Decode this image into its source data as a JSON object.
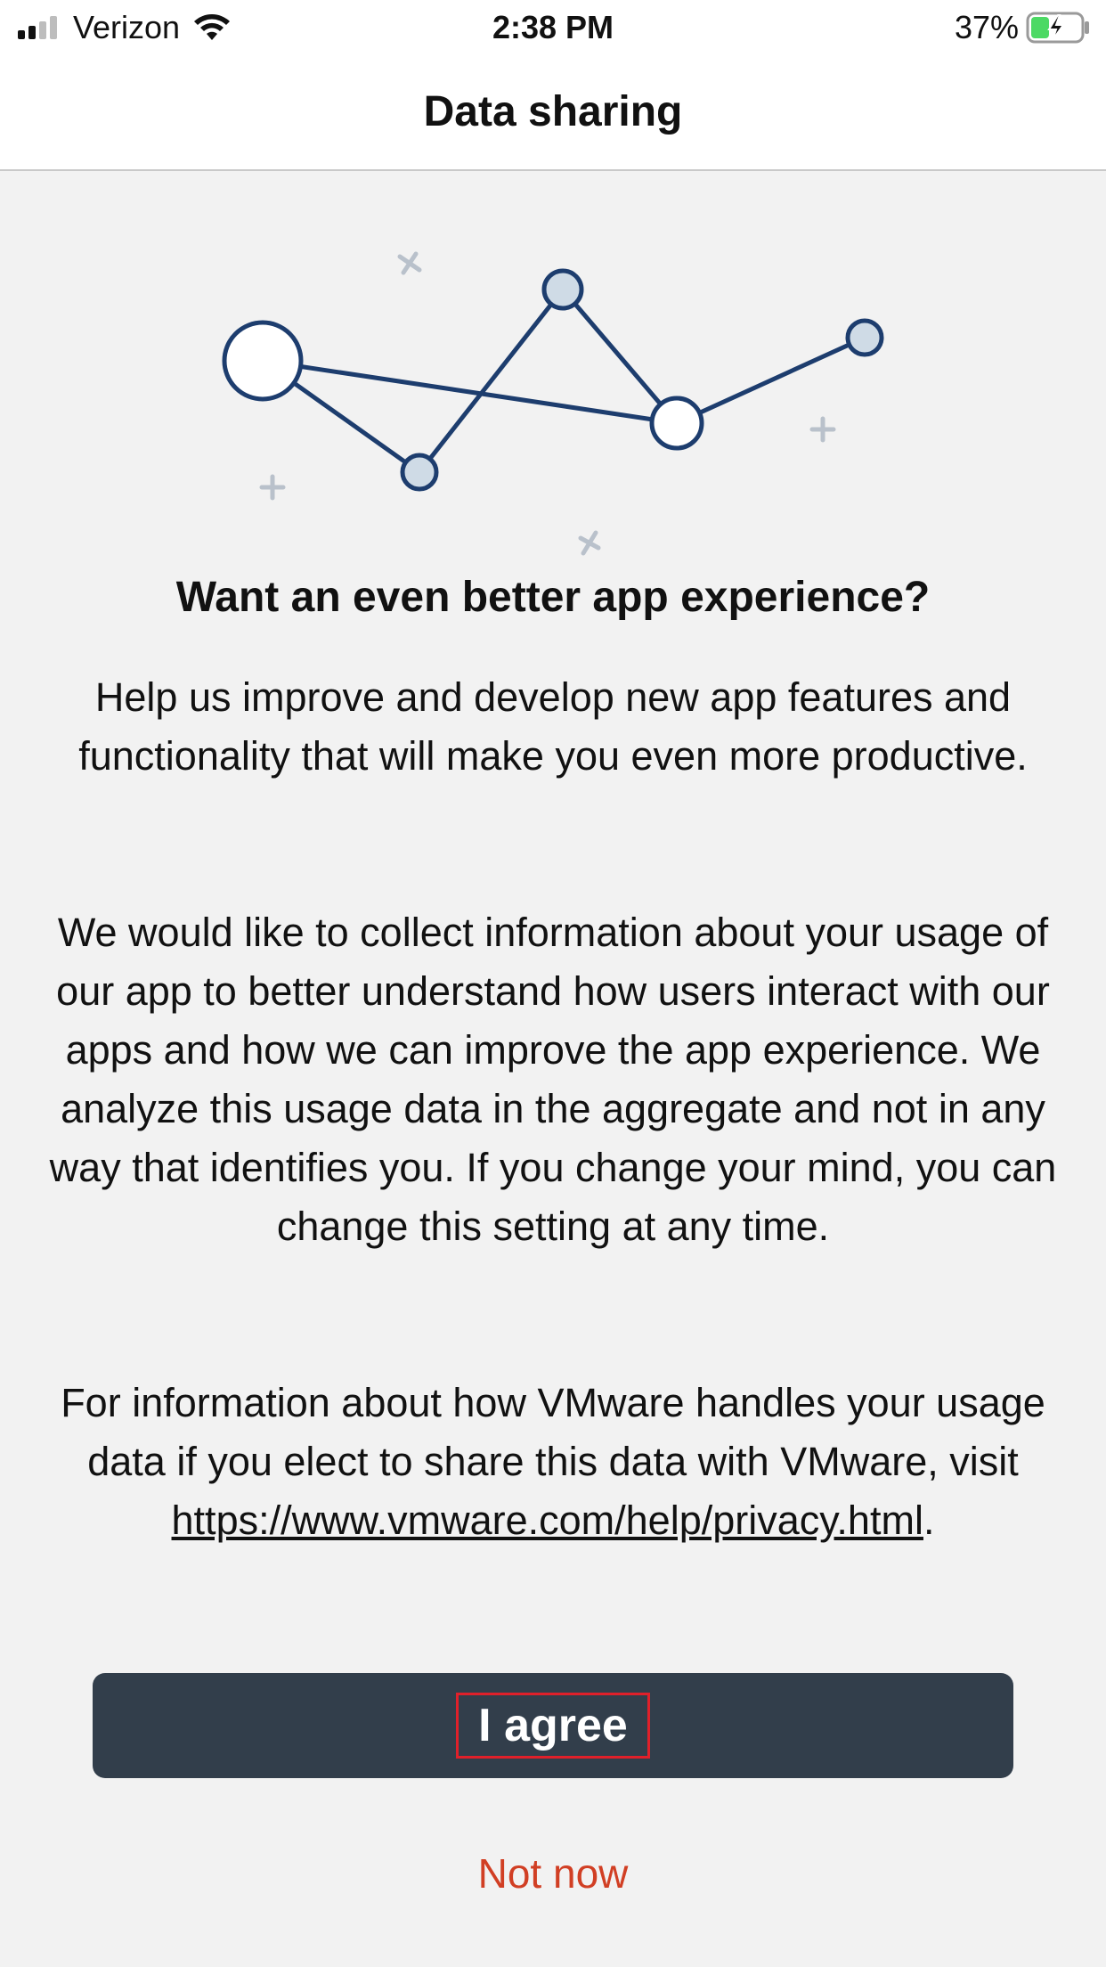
{
  "status_bar": {
    "carrier": "Verizon",
    "time": "2:38 PM",
    "battery_percent": "37%",
    "signal_icon": "cellular-signal-icon",
    "wifi_icon": "wifi-icon",
    "battery_icon": "battery-charging-icon",
    "battery_level": 0.37
  },
  "nav": {
    "title": "Data sharing"
  },
  "illustration": {
    "icon": "network-graph-icon"
  },
  "content": {
    "headline": "Want an even better app experience?",
    "paragraph1": "Help us improve and develop new app features and functionality that will make you even more productive.",
    "paragraph2": "We would like to collect information about your usage of our app to better understand how users interact with our apps and how we can improve the app experience. We analyze this usage data in the aggregate and not in any way that identifies you. If you change your mind, you can change this setting at any time.",
    "paragraph3_prefix": "For information about how VMware handles your usage data if you elect to share this data with VMware, visit ",
    "paragraph3_link": "https://www.vmware.com/help/privacy.html",
    "paragraph3_suffix": "."
  },
  "actions": {
    "agree_label": "I agree",
    "not_now_label": "Not now"
  },
  "colors": {
    "primary_button": "#323e4b",
    "secondary_action": "#d13f24",
    "illustration_stroke": "#1d3d6e",
    "battery_fill": "#4cd964"
  }
}
